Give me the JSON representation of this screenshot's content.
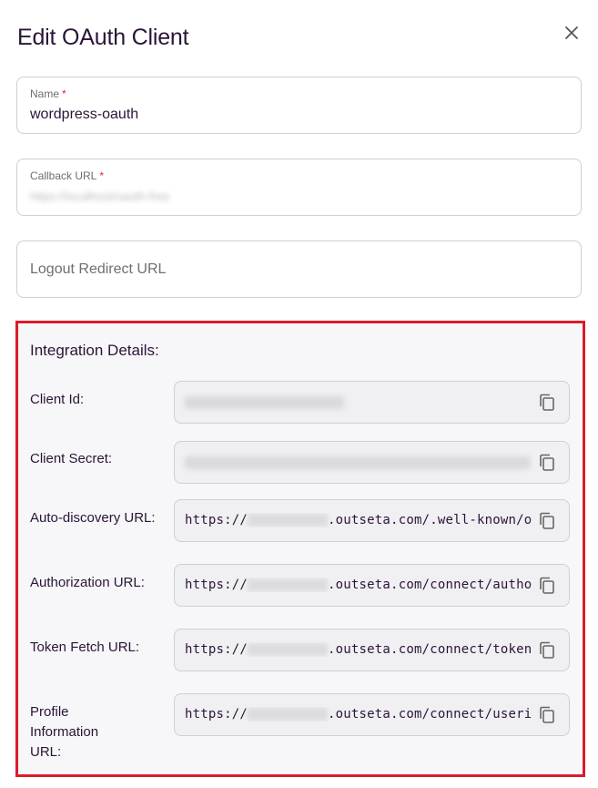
{
  "dialog": {
    "title": "Edit OAuth Client",
    "close_icon": "close-icon"
  },
  "fields": {
    "name": {
      "label": "Name",
      "required_mark": "*",
      "value": "wordpress-oauth"
    },
    "callback_url": {
      "label": "Callback URL",
      "required_mark": "*",
      "value": "https://localhost/oauth-free"
    },
    "logout_redirect_url": {
      "placeholder": "Logout Redirect URL"
    }
  },
  "integration": {
    "heading": "Integration Details:",
    "client_id": {
      "label": "Client Id:"
    },
    "client_secret": {
      "label": "Client Secret:"
    },
    "auto_discovery": {
      "label": "Auto-discovery URL:",
      "prefix": "https://",
      "suffix": ".outseta.com/.well-known/openid-configuration"
    },
    "authorization": {
      "label": "Authorization URL:",
      "prefix": "https://",
      "suffix": ".outseta.com/connect/authorize"
    },
    "token_fetch": {
      "label": "Token Fetch URL:",
      "prefix": "https://",
      "suffix": ".outseta.com/connect/token"
    },
    "profile_information": {
      "label": "Profile Information URL:",
      "prefix": "https://",
      "suffix": ".outseta.com/connect/userinfo"
    },
    "copy_icon": "copy-icon"
  },
  "colors": {
    "highlight_border": "#dc1c2b",
    "required": "#d32f2f",
    "text": "#2a1537"
  }
}
